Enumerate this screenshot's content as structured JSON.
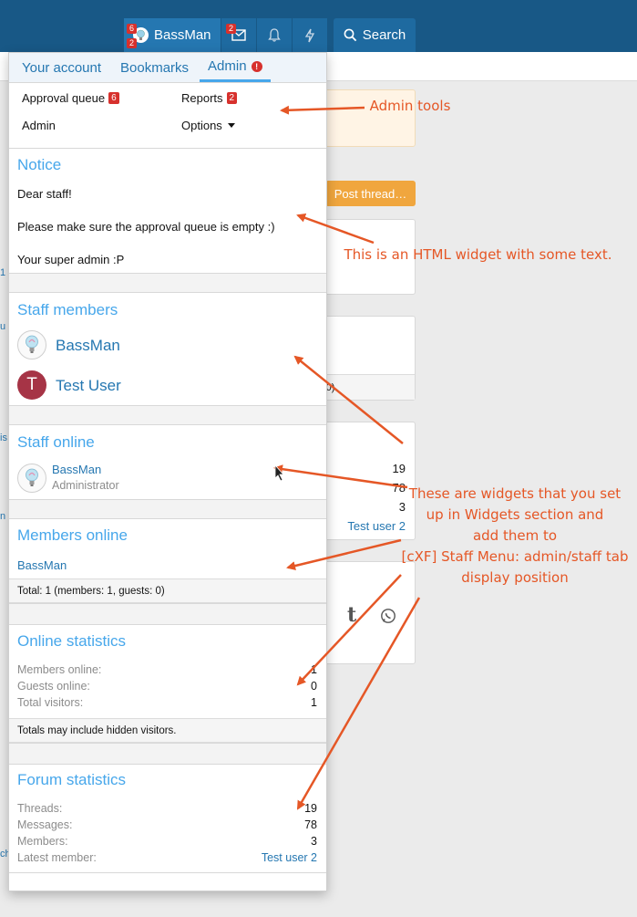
{
  "topbar": {
    "user_name": "BassMan",
    "user_badge_top": "6",
    "user_badge_bottom": "2",
    "inbox_badge": "2",
    "search_label": "Search"
  },
  "background": {
    "post_thread": "Post thread…",
    "stats_values": [
      "19",
      "78",
      "3"
    ],
    "latest_member": "Test user 2",
    "partial_text": "ts: 0)"
  },
  "menu": {
    "tabs": [
      {
        "label": "Your account"
      },
      {
        "label": "Bookmarks"
      },
      {
        "label": "Admin"
      }
    ],
    "admin_links": {
      "approval_queue": "Approval queue",
      "approval_count": "6",
      "reports": "Reports",
      "reports_count": "2",
      "admin": "Admin",
      "options": "Options"
    },
    "notice": {
      "title": "Notice",
      "line1": "Dear staff!",
      "line2": "Please make sure the approval queue is empty :)",
      "line3": "Your super admin :P"
    },
    "staff_members": {
      "title": "Staff members",
      "members": [
        {
          "name": "BassMan"
        },
        {
          "name": "Test User",
          "initial": "T"
        }
      ]
    },
    "staff_online": {
      "title": "Staff online",
      "name": "BassMan",
      "role": "Administrator"
    },
    "members_online": {
      "title": "Members online",
      "name": "BassMan",
      "total": "Total: 1 (members: 1, guests: 0)"
    },
    "online_stats": {
      "title": "Online statistics",
      "rows": [
        {
          "label": "Members online:",
          "value": "1"
        },
        {
          "label": "Guests online:",
          "value": "0"
        },
        {
          "label": "Total visitors:",
          "value": "1"
        }
      ],
      "footer": "Totals may include hidden visitors."
    },
    "forum_stats": {
      "title": "Forum statistics",
      "rows": [
        {
          "label": "Threads:",
          "value": "19"
        },
        {
          "label": "Messages:",
          "value": "78"
        },
        {
          "label": "Members:",
          "value": "3"
        },
        {
          "label": "Latest member:",
          "value": "Test user 2"
        }
      ]
    }
  },
  "annotations": {
    "admin_tools": "Admin tools",
    "html_widget": "This is an HTML widget with some text.",
    "widgets_note": [
      "These are widgets that you set",
      "up in Widgets section and",
      "add them to",
      "[cXF] Staff Menu: admin/staff tab",
      "display position"
    ]
  },
  "colors": {
    "annotation": "#e55726",
    "header": "#185886",
    "link": "#2577b1",
    "widget_title": "#47a7eb",
    "badge": "#d7312d"
  }
}
